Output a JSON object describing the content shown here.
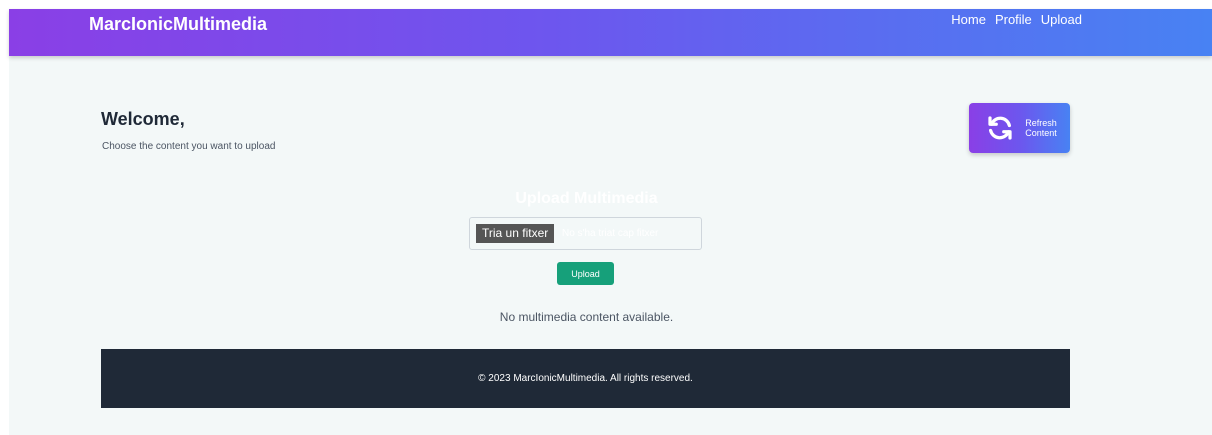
{
  "navbar": {
    "brand": "MarcIonicMultimedia",
    "links": [
      "Home",
      "Profile",
      "Upload"
    ]
  },
  "welcome": {
    "title": "Welcome,",
    "subtitle": "Choose the content you want to upload"
  },
  "refresh_button": {
    "icon": "refresh-icon",
    "line1": "Refresh",
    "line2": "Content"
  },
  "upload_form": {
    "title": "Upload Multimedia",
    "file_button_label": "Tria un fitxer",
    "file_status": "No s'ha triat cap fitxer",
    "submit_label": "Upload"
  },
  "content": {
    "empty_message": "No multimedia content available."
  },
  "footer": {
    "text": "© 2023 MarcIonicMultimedia. All rights reserved."
  },
  "colors": {
    "gradient_start": "#8a3fe6",
    "gradient_end": "#4882f3",
    "upload_button": "#16a07a",
    "footer_bg": "#1f2937",
    "page_bg": "#f3f8f8"
  }
}
